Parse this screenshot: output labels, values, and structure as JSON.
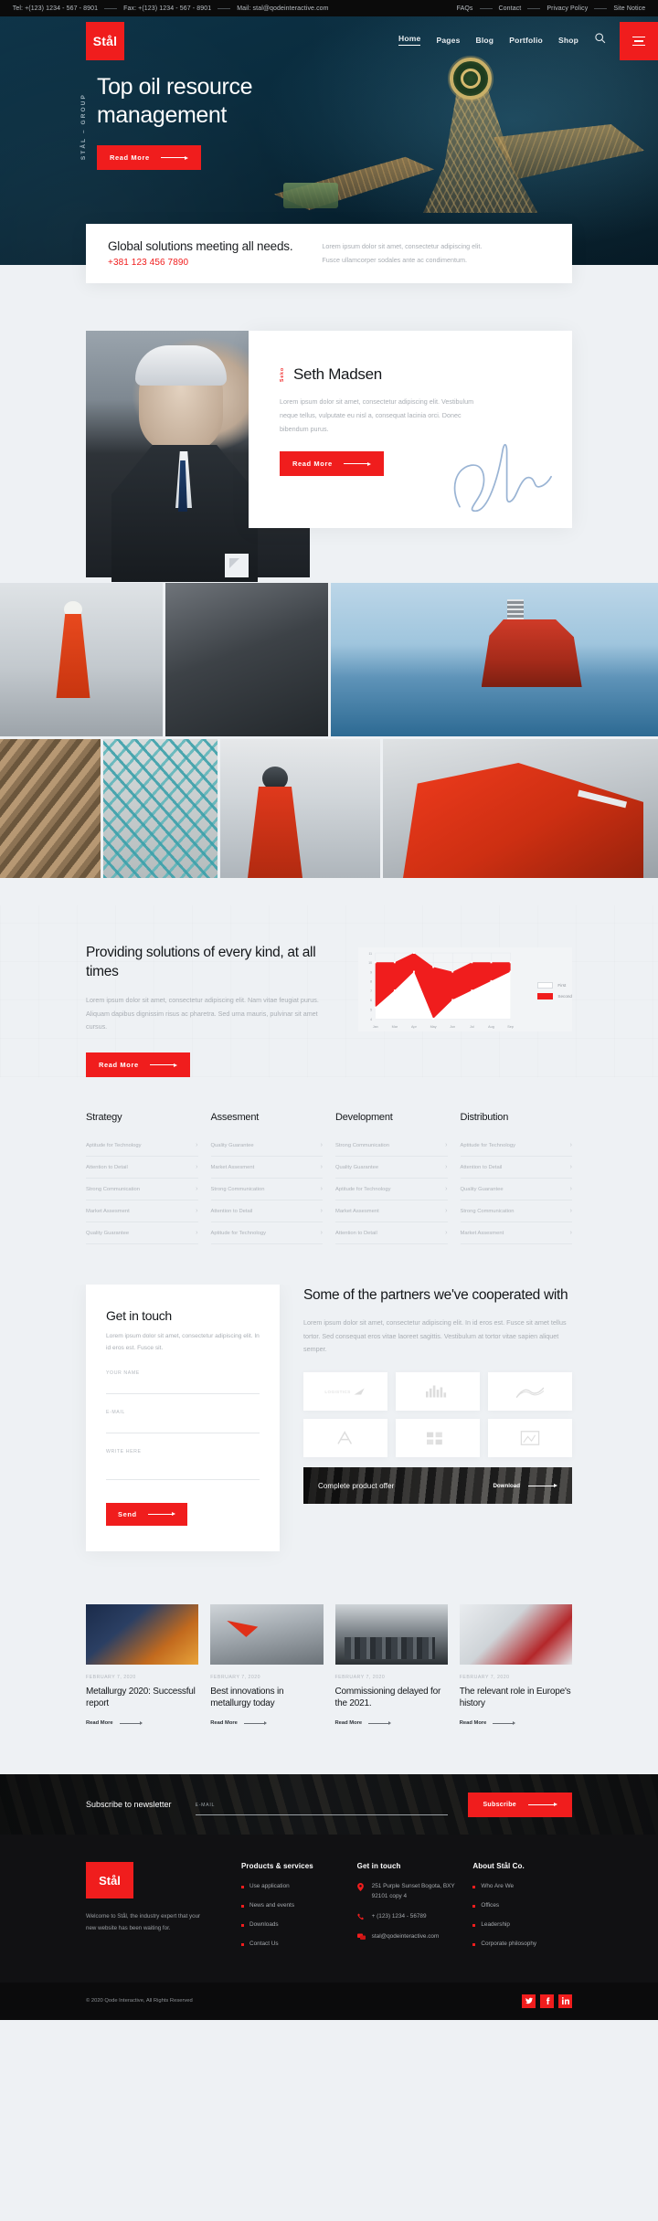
{
  "topbar": {
    "tel": "Tel: +(123) 1234 - 567 - 8901",
    "fax": "Fax: +(123) 1234 - 567 - 8901",
    "mail": "Mail: stal@qodeinteractive.com",
    "links": [
      "FAQs",
      "Contact",
      "Privacy Policy",
      "Site Notice"
    ]
  },
  "nav": {
    "logo": "Stål",
    "items": [
      "Home",
      "Pages",
      "Blog",
      "Portfolio",
      "Shop"
    ],
    "active": "Home",
    "search_icon": "search-icon",
    "menu_icon": "hamburger-icon"
  },
  "hero": {
    "vertical": "STÅL – GROUP",
    "title": "Top oil resource management",
    "cta": "Read More"
  },
  "infobar": {
    "heading": "Global solutions meeting all needs.",
    "phone": "+381 123 456 7890",
    "text_line1": "Lorem ipsum dolor sit amet, consectetur adipiscing elit.",
    "text_line2": "Fusce ullamcorper sodales ante ac condimentum."
  },
  "person": {
    "vertical": "Seko",
    "name": "Seth Madsen",
    "text": "Lorem ipsum dolor sit amet, consectetur adipiscing elit. Vestibulum neque tellus, vulputate eu nisl a, consequat lacinia orci. Donec bibendum purus.",
    "cta": "Read More"
  },
  "solutions": {
    "heading": "Providing solutions of every kind, at all times",
    "text": "Lorem ipsum dolor sit amet, consectetur adipiscing elit. Nam vitae feugiat purus. Aliquam dapibus dignissim risus ac pharetra. Sed urna mauris, pulvinar sit amet cursus.",
    "cta": "Read More"
  },
  "chart_data": {
    "type": "area",
    "title": "",
    "xlabel": "",
    "ylabel": "",
    "categories": [
      "Jan",
      "Mar",
      "Apr",
      "May",
      "Jun",
      "Jul",
      "Aug",
      "Sep"
    ],
    "ylim": [
      4,
      11
    ],
    "yticks": [
      4,
      5,
      6,
      7,
      8,
      9,
      10,
      11
    ],
    "grid": true,
    "legend_position": "right",
    "series": [
      {
        "name": "First",
        "values": [
          5.2,
          7.0,
          9.0,
          4.0,
          6.0,
          7.0,
          8.0,
          9.0
        ],
        "color": "#ffffff"
      },
      {
        "name": "Second",
        "values": [
          10.0,
          10.0,
          11.0,
          9.5,
          9.0,
          10.0,
          10.0,
          10.0
        ],
        "color": "#f01d1d"
      }
    ]
  },
  "skills": {
    "columns": [
      {
        "title": "Strategy",
        "items": [
          "Aptitude for Technology",
          "Attention to Detail",
          "Strong Communication",
          "Market Assesment",
          "Quality Guarantee"
        ]
      },
      {
        "title": "Assesment",
        "items": [
          "Quality Guarantee",
          "Market Assesment",
          "Strong Communication",
          "Attention to Detail",
          "Aptitude for Technology"
        ]
      },
      {
        "title": "Development",
        "items": [
          "Strong Communication",
          "Quality Guarantee",
          "Aptitude for Technology",
          "Market Assesment",
          "Attention to Detail"
        ]
      },
      {
        "title": "Distribution",
        "items": [
          "Aptitude for Technology",
          "Attention to Detail",
          "Quality Guarantee",
          "Strong Communication",
          "Market Assesment"
        ]
      }
    ]
  },
  "contact": {
    "heading": "Get in touch",
    "text": "Lorem ipsum dolor sit amet, consectetur adipiscing elit. In id eros est. Fusce sit.",
    "name_label": "YOUR NAME",
    "name_value": "",
    "email_label": "E-MAIL",
    "email_value": "",
    "message_label": "WRITE HERE",
    "message_value": "",
    "send": "Send"
  },
  "partners": {
    "heading": "Some of the partners we've cooperated with",
    "text": "Lorem ipsum dolor sit amet, consectetur adipiscing elit. In id eros est. Fusce sit amet tellus tortor. Sed consequat eros vitae laoreet sagittis. Vestibulum at tortor vitae sapien aliquet semper.",
    "logos": [
      "logistics-logo",
      "bars-logo",
      "mountain-logo",
      "monogram-logo",
      "grid-logo",
      "frame-logo"
    ]
  },
  "product_banner": {
    "title": "Complete product offer",
    "download": "Download"
  },
  "blog": {
    "posts": [
      {
        "date": "FEBRUARY 7, 2020",
        "title": "Metallurgy 2020: Successful report",
        "more": "Read More"
      },
      {
        "date": "FEBRUARY 7, 2020",
        "title": "Best innovations in metallurgy today",
        "more": "Read More"
      },
      {
        "date": "FEBRUARY 7, 2020",
        "title": "Commissioning delayed for the 2021.",
        "more": "Read More"
      },
      {
        "date": "FEBRUARY 7, 2020",
        "title": "The relevant role in Europe's history",
        "more": "Read More"
      }
    ]
  },
  "newsletter": {
    "title": "Subscribe to newsletter",
    "placeholder": "E-MAIL",
    "value": "",
    "button": "Subscribe"
  },
  "footer": {
    "logo": "Stål",
    "about": "Welcome to Stål, the industry expert that your new website has been waiting for.",
    "products": {
      "title": "Products & services",
      "items": [
        "Use application",
        "News and events",
        "Downloads",
        "Contact Us"
      ]
    },
    "touch": {
      "title": "Get in touch",
      "address": "251 Purple Sunset Bogota, BXY 92101 copy 4",
      "phone": "+ (123) 1234 - 56789",
      "email": "stal@qodeinteractive.com"
    },
    "about_co": {
      "title": "About Stål Co.",
      "items": [
        "Who Are We",
        "Offices",
        "Leadership",
        "Corporate philosophy"
      ]
    },
    "copyright": "© 2020 Qode Interactive, All Rights Reserved",
    "socials": [
      "twitter-icon",
      "facebook-icon",
      "linkedin-icon"
    ]
  },
  "colors": {
    "accent": "#f01d1d",
    "dark": "#111113",
    "hero": "#0a2c3e",
    "bg": "#eef1f4"
  }
}
